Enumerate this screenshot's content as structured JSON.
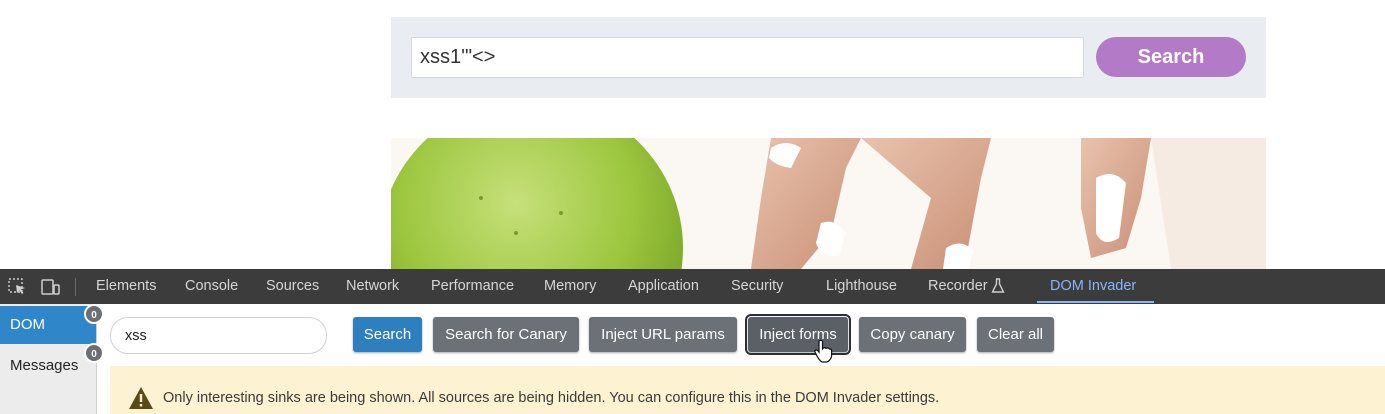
{
  "site": {
    "search_value": "xss1'\"<>",
    "search_button": "Search"
  },
  "hero_image": {
    "name": "fruit-and-hand-image"
  },
  "devtools": {
    "toolbar_icons": [
      "inspect-element-icon",
      "device-toolbar-icon"
    ],
    "tabs": [
      {
        "label": "Elements"
      },
      {
        "label": "Console"
      },
      {
        "label": "Sources"
      },
      {
        "label": "Network"
      },
      {
        "label": "Performance"
      },
      {
        "label": "Memory"
      },
      {
        "label": "Application"
      },
      {
        "label": "Security"
      },
      {
        "label": "Lighthouse"
      },
      {
        "label": "Recorder"
      },
      {
        "label": "DOM Invader"
      }
    ],
    "active_tab": "DOM Invader",
    "recorder_icon": "flask-icon"
  },
  "dom_invader": {
    "sidebar": [
      {
        "label": "DOM",
        "count": "0"
      },
      {
        "label": "Messages",
        "count": "0"
      }
    ],
    "search_value": "xss",
    "buttons": {
      "search": "Search",
      "search_canary": "Search for Canary",
      "inject_url": "Inject URL params",
      "inject_forms": "Inject forms",
      "copy_canary": "Copy canary",
      "clear_all": "Clear all"
    },
    "warning": "Only interesting sinks are being shown. All sources are being hidden. You can configure this in the DOM Invader settings."
  },
  "colors": {
    "site_button": "#b27ac7",
    "devtools_bg": "#3c3c3c",
    "active_tab": "#8ab4f8",
    "primary_button": "#2e7fbf",
    "warning_bg": "#fdf3d3"
  }
}
